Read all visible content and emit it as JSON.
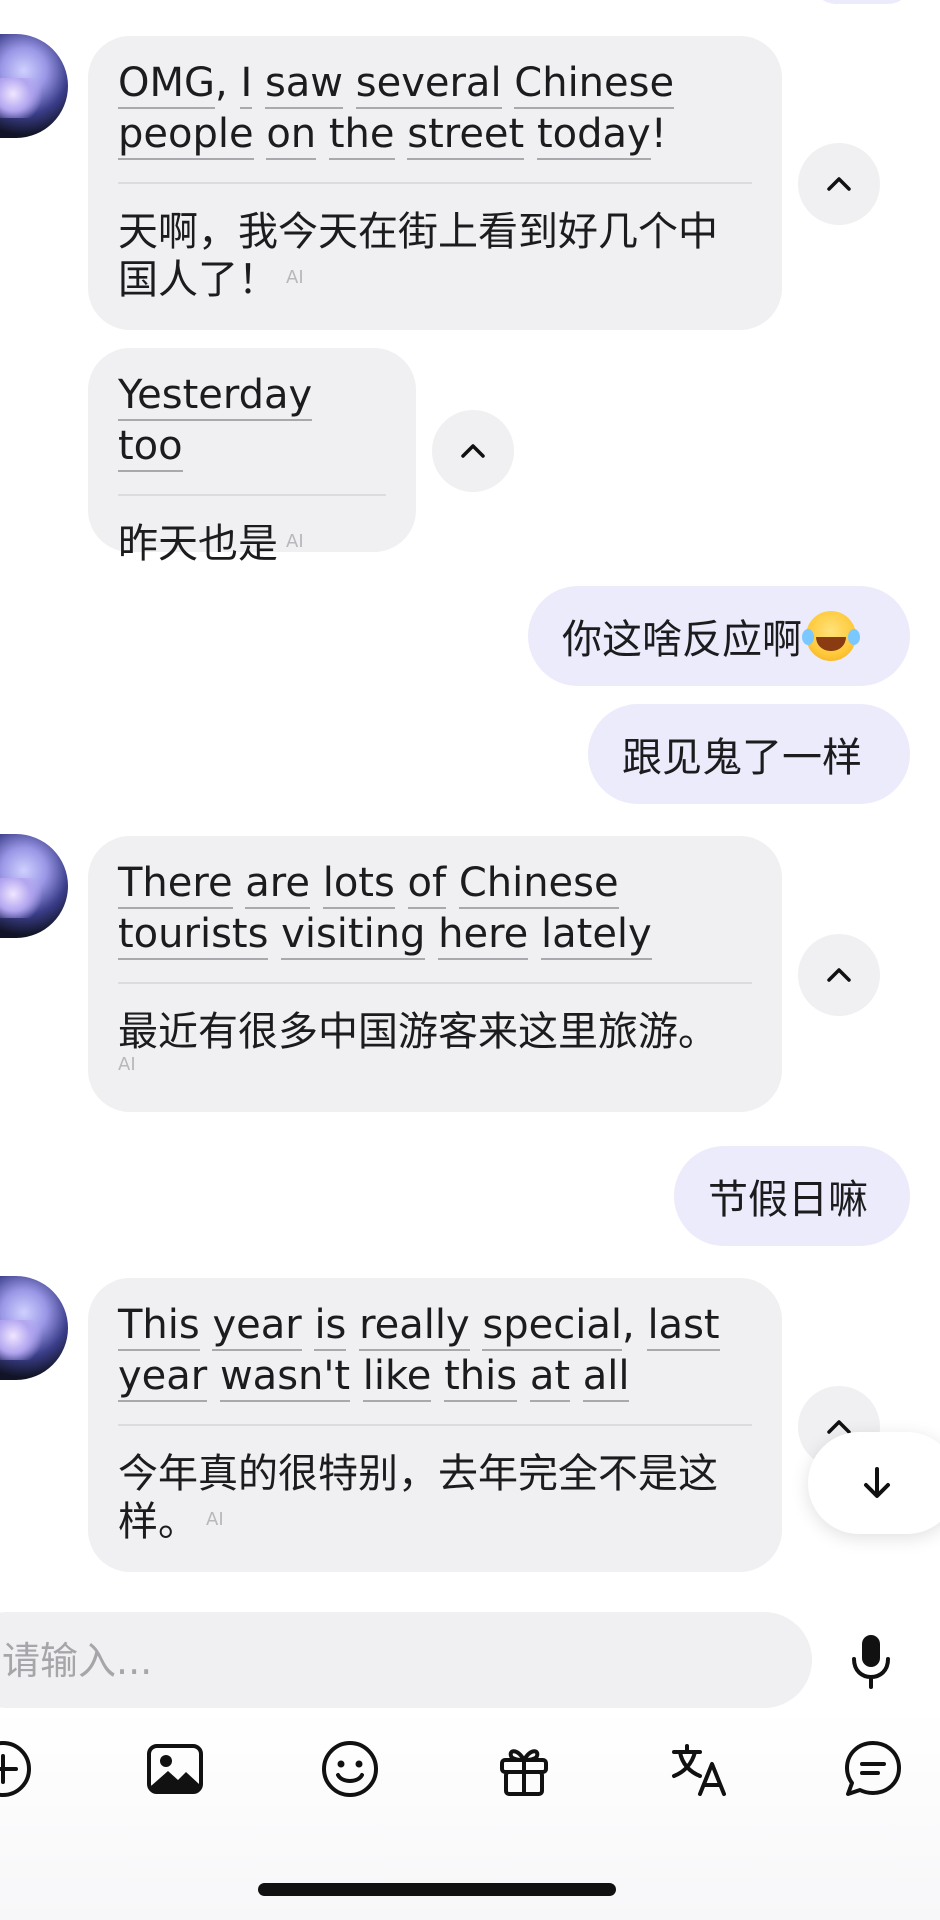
{
  "messages": {
    "m1": {
      "en_line1": [
        "OMG",
        ", ",
        "I",
        " ",
        "saw",
        " ",
        "several",
        " ",
        "Chinese"
      ],
      "en_line2": [
        "people",
        " ",
        "on",
        " ",
        "the",
        " ",
        "street",
        " ",
        "today",
        "!"
      ],
      "zh": "天啊，我今天在街上看到好几个中国人了！",
      "ai": "AI"
    },
    "m2": {
      "en_line1": [
        "Yesterday",
        " ",
        "too"
      ],
      "zh": "昨天也是",
      "ai": "AI"
    },
    "out1": {
      "text": "你这啥反应啊"
    },
    "out2": {
      "text": "跟见鬼了一样"
    },
    "m3": {
      "en_line1": [
        "There",
        " ",
        "are",
        " ",
        "lots",
        " ",
        "of",
        " ",
        "Chinese"
      ],
      "en_line2": [
        "tourists",
        " ",
        "visiting",
        " ",
        "here",
        " ",
        "lately"
      ],
      "zh": "最近有很多中国游客来这里旅游。",
      "ai": "AI"
    },
    "out3": {
      "text": "节假日嘛"
    },
    "m4": {
      "en_line1": [
        "This",
        " ",
        "year",
        " ",
        "is",
        " ",
        "really",
        " ",
        "special",
        ", ",
        "last"
      ],
      "en_line2": [
        "year",
        " ",
        "wasn't",
        " ",
        "like",
        " ",
        "this",
        " ",
        "at",
        " ",
        "all"
      ],
      "zh": "今年真的很特别，去年完全不是这样。",
      "ai": "AI"
    }
  },
  "composer": {
    "placeholder": "请输入..."
  },
  "icons": {
    "collapse": "chevron-up-icon",
    "scroll_down": "arrow-down-icon",
    "mic": "microphone-icon",
    "toolbar": [
      "plus-circle-icon",
      "image-icon",
      "emoji-icon",
      "gift-icon",
      "translate-icon",
      "chat-icon"
    ]
  },
  "colors": {
    "incoming_bubble": "#f0f0f2",
    "outgoing_bubble": "#ecebfc",
    "text": "#1c1c1e"
  }
}
